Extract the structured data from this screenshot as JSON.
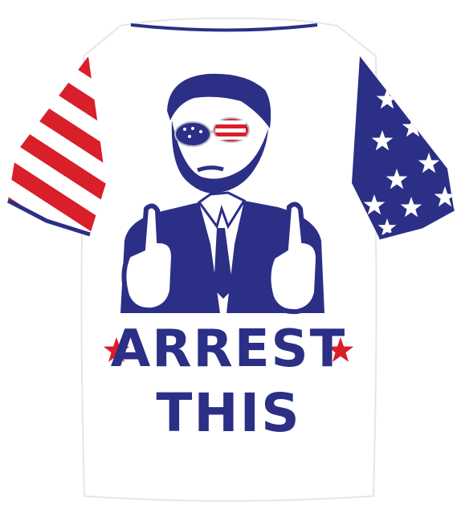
{
  "product": {
    "shirt_color": "#ffffff",
    "navy": "#2b2f86",
    "red": "#d81f2a",
    "star_color": "#ffffff",
    "icons": [
      "american-flag-stripes-icon",
      "american-flag-stars-icon",
      "star-icon",
      "portrait-graphic",
      "sunglasses-icon"
    ]
  },
  "print": {
    "line1": "ARREST",
    "line2": "THIS"
  }
}
